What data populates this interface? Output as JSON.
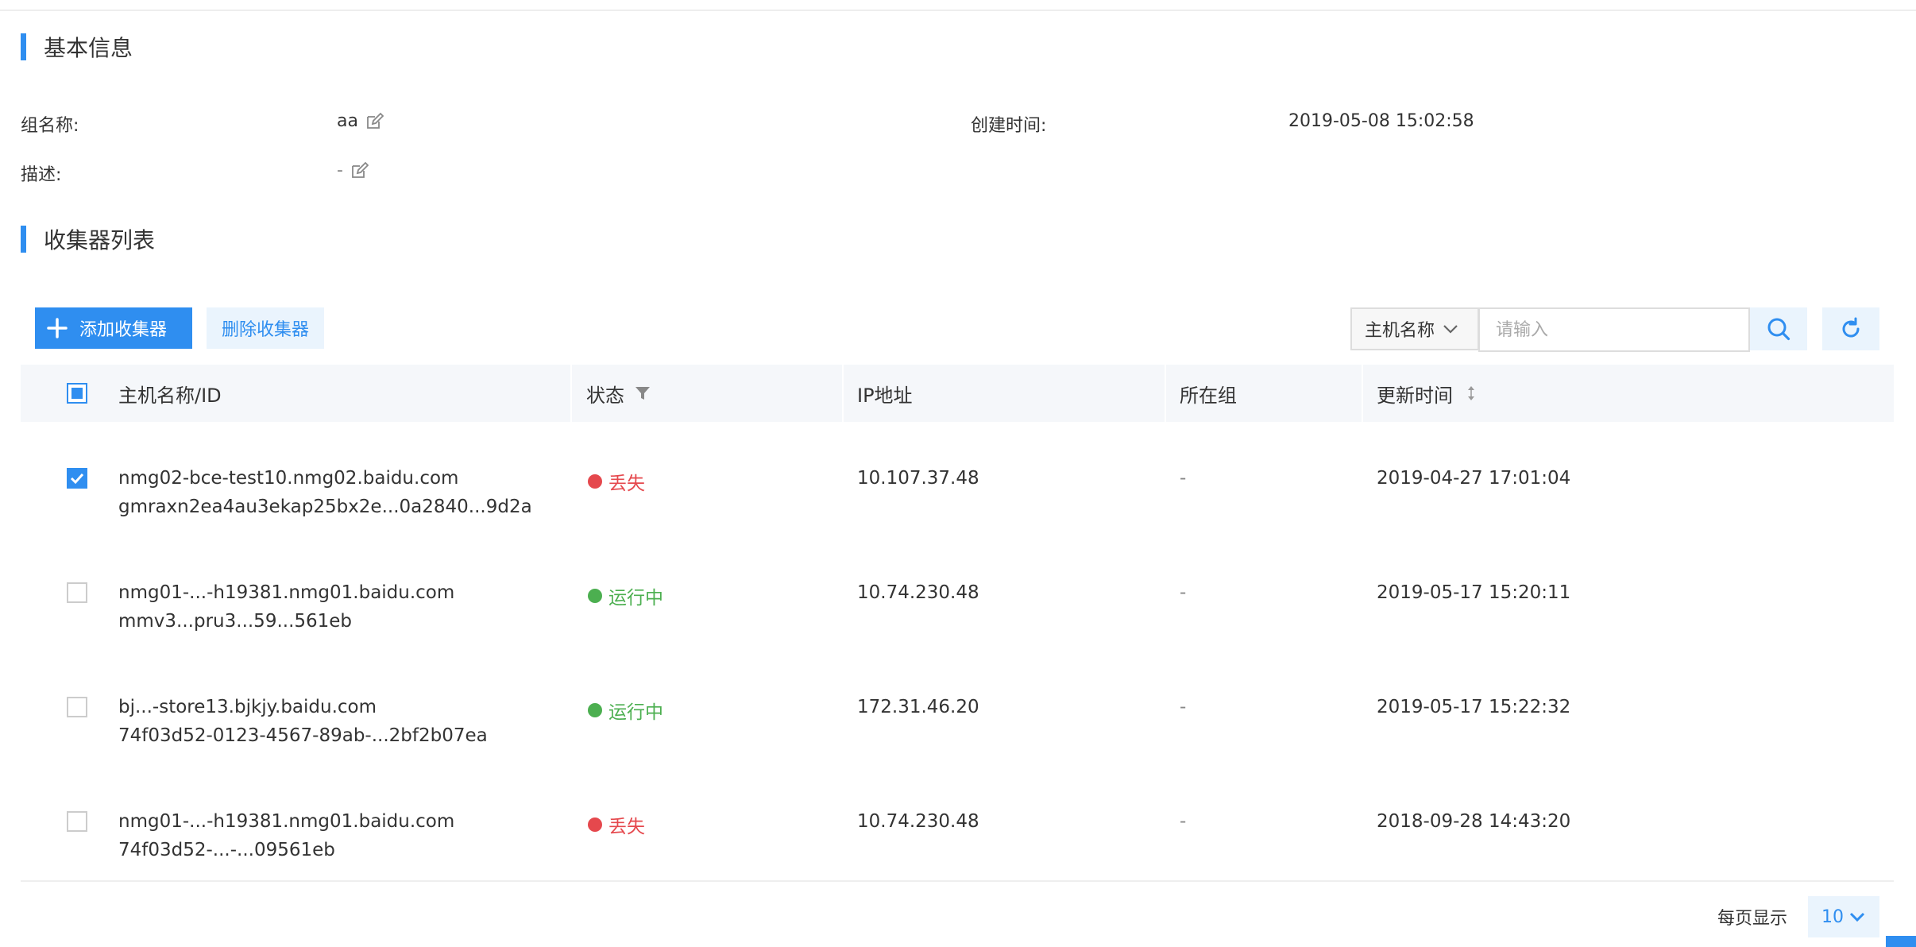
{
  "basic_info": {
    "title": "基本信息",
    "group_name_label": "组名称:",
    "group_name_value": "aa",
    "created_label": "创建时间:",
    "created_value": "2019-05-08 15:02:58",
    "description_label": "描述:",
    "description_value": "-"
  },
  "collector_list": {
    "title": "收集器列表",
    "add_button": "添加收集器",
    "delete_button": "删除收集器",
    "search_field_selected": "主机名称",
    "search_placeholder": "请输入"
  },
  "table": {
    "headers": {
      "host": "主机名称/ID",
      "status": "状态",
      "ip": "IP地址",
      "group": "所在组",
      "updated": "更新时间"
    },
    "rows": [
      {
        "checked": true,
        "host_name": "nmg02-bce-test10.nmg02.baidu.com",
        "host_id": "gmraxn2ea4au3ekap25bx2e...0a2840...9d2a",
        "status": "丢失",
        "status_type": "lost",
        "ip": "10.107.37.48",
        "group": "-",
        "updated": "2019-04-27 17:01:04"
      },
      {
        "checked": false,
        "host_name": "nmg01-...-h19381.nmg01.baidu.com",
        "host_id": "mmv3...pru3...59...561eb",
        "status": "运行中",
        "status_type": "run",
        "ip": "10.74.230.48",
        "group": "-",
        "updated": "2019-05-17 15:20:11"
      },
      {
        "checked": false,
        "host_name": "bj...-store13.bjkjy.baidu.com",
        "host_id": "74f03d52-0123-4567-89ab-...2bf2b07ea",
        "status": "运行中",
        "status_type": "run",
        "ip": "172.31.46.20",
        "group": "-",
        "updated": "2019-05-17 15:22:32"
      },
      {
        "checked": false,
        "host_name": "nmg01-...-h19381.nmg01.baidu.com",
        "host_id": "74f03d52-...-...09561eb",
        "status": "丢失",
        "status_type": "lost",
        "ip": "10.74.230.48",
        "group": "-",
        "updated": "2018-09-28 14:43:20"
      }
    ]
  },
  "pagination": {
    "per_page_label": "每页显示",
    "per_page_value": "10"
  },
  "colors": {
    "accent": "#2f8ef0",
    "lost": "#e5484d",
    "running": "#4caf50"
  }
}
